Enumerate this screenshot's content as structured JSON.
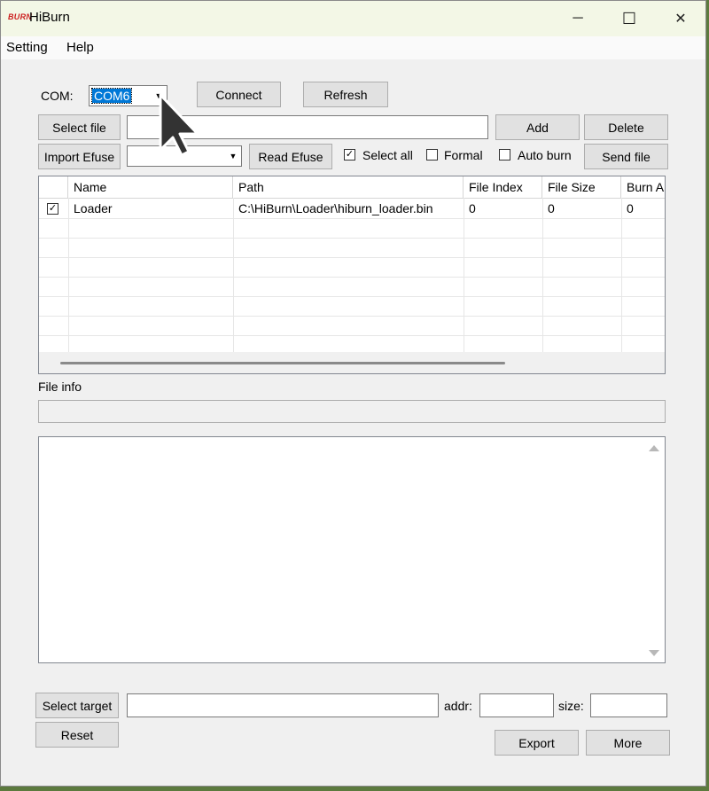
{
  "window": {
    "title": "HiBurn",
    "logo_text": "BURN"
  },
  "window_controls": {
    "minimize": "─",
    "maximize": "☐",
    "close": "✕"
  },
  "menu": {
    "setting": "Setting",
    "help": "Help"
  },
  "com": {
    "label": "COM:",
    "selected": "COM6"
  },
  "buttons": {
    "connect": "Connect",
    "refresh": "Refresh",
    "select_file": "Select file",
    "add": "Add",
    "delete": "Delete",
    "import_efuse": "Import Efuse",
    "read_efuse": "Read Efuse",
    "send_file": "Send file",
    "select_target": "Select target",
    "reset": "Reset",
    "export": "Export",
    "more": "More"
  },
  "options": {
    "select_all": {
      "label": "Select all",
      "checked": true
    },
    "formal": {
      "label": "Formal",
      "checked": false
    },
    "auto_burn": {
      "label": "Auto burn",
      "checked": false
    }
  },
  "table": {
    "columns": [
      "Name",
      "Path",
      "File Index",
      "File Size",
      "Burn A"
    ],
    "rows": [
      {
        "checked": true,
        "name": "Loader",
        "path": "C:\\HiBurn\\Loader\\hiburn_loader.bin",
        "file_index": "0",
        "file_size": "0",
        "burn_addr": "0"
      }
    ]
  },
  "file_info": {
    "label": "File info"
  },
  "target": {
    "addr_label": "addr:",
    "size_label": "size:"
  },
  "icons": {
    "check": "✓",
    "dropdown": "▼"
  }
}
